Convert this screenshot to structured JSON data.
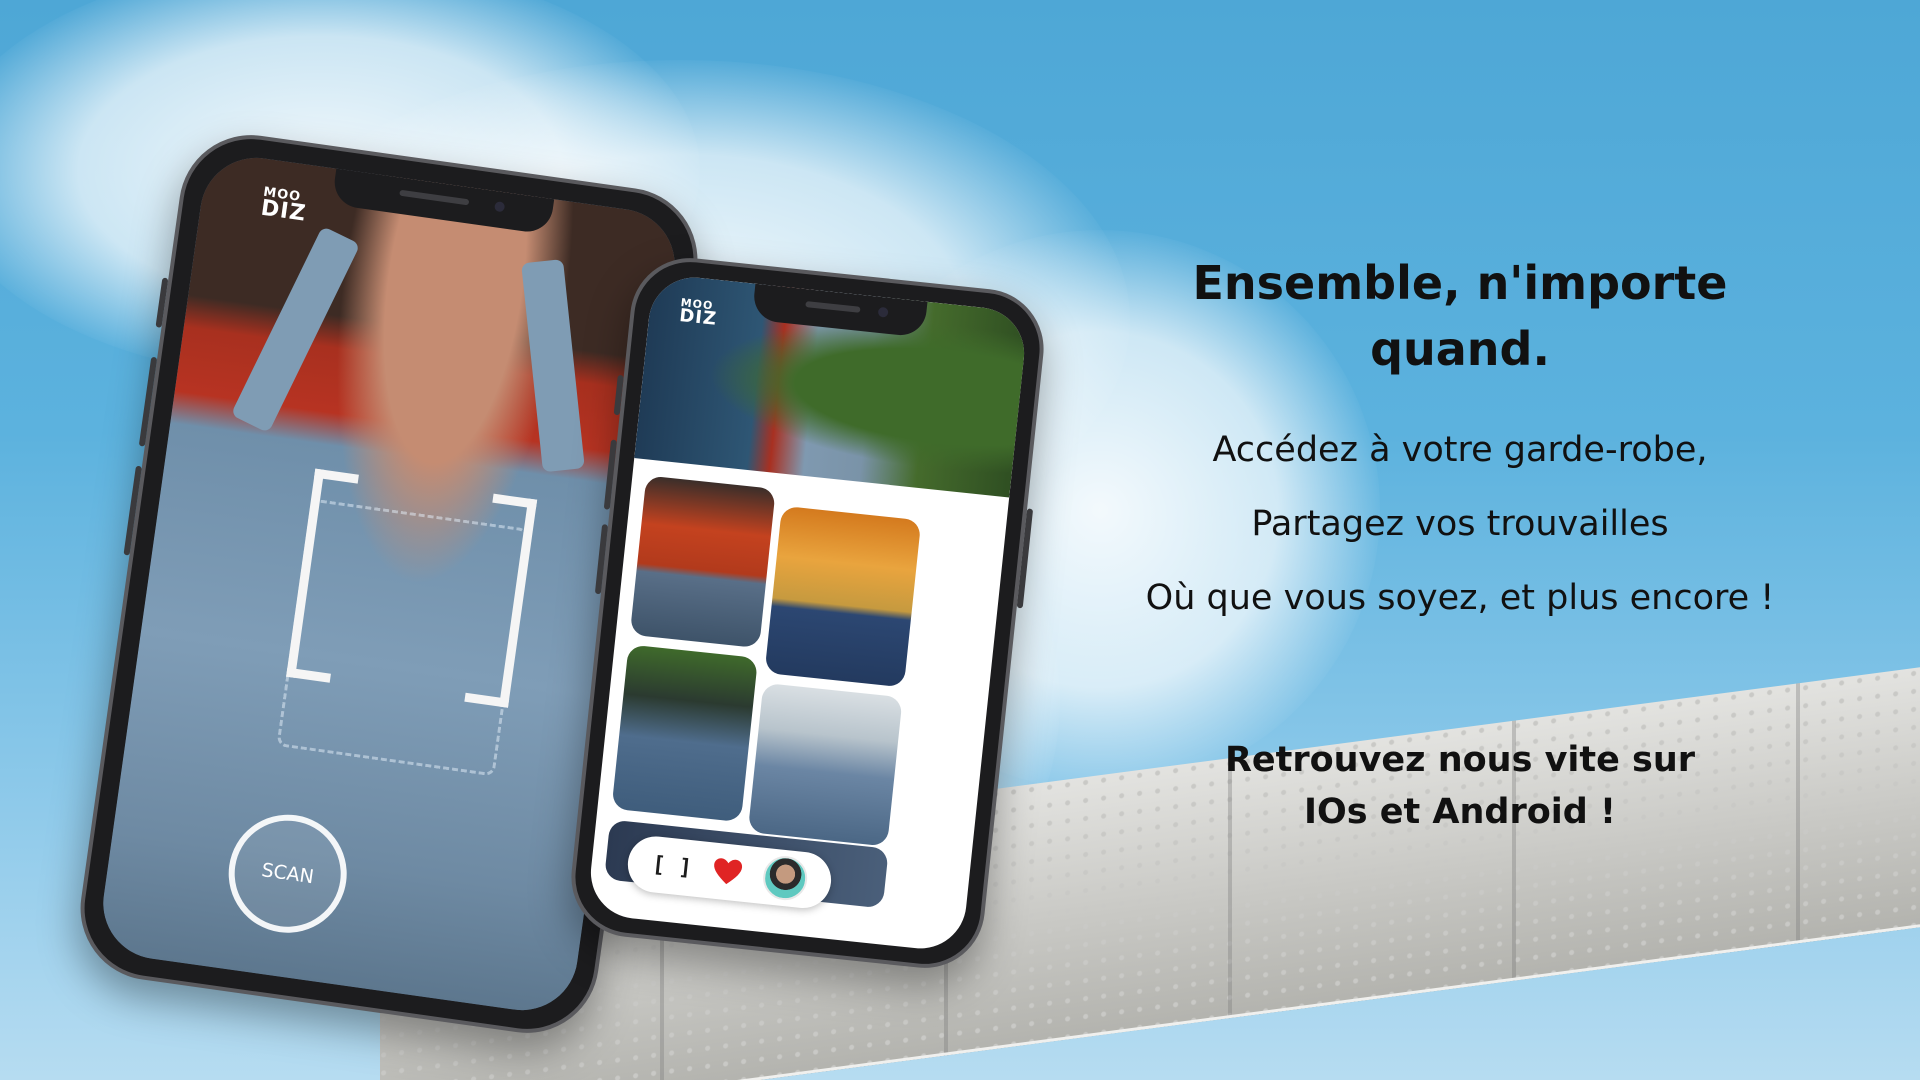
{
  "background": {
    "sky_color": "#5cb2de"
  },
  "phone_scan": {
    "logo_line1": "MOO",
    "logo_line2": "DIZ",
    "scan_button_label": "SCAN",
    "chevron_icon": "chevron-right-icon"
  },
  "phone_feed": {
    "logo_line1": "MOO",
    "logo_line2": "DIZ",
    "tabbar": {
      "scan_label": "[ ]",
      "heart_icon": "heart-icon",
      "heart_color": "#e02424",
      "avatar_icon": "avatar"
    }
  },
  "headline": {
    "line1": "Ensemble, n'importe",
    "line2": "quand."
  },
  "taglines": [
    "Accédez à votre garde-robe,",
    "Partagez vos trouvailles",
    "Où que vous soyez, et plus encore !"
  ],
  "cta": {
    "line1": "Retrouvez nous vite sur",
    "line2": "IOs et Android !"
  }
}
